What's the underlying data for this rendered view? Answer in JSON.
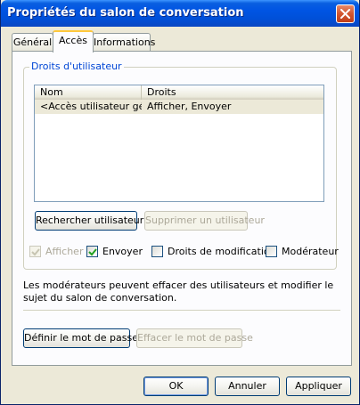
{
  "window": {
    "title": "Propriétés du salon de conversation"
  },
  "tabs": [
    {
      "label": "Général",
      "active": false
    },
    {
      "label": "Accès",
      "active": true
    },
    {
      "label": "Informations",
      "active": false
    }
  ],
  "rights_group": {
    "label": "Droits d'utilisateur",
    "columns": [
      "Nom",
      "Droits"
    ],
    "rows": [
      {
        "name": "<Accès utilisateur gé...",
        "rights": "Afficher, Envoyer"
      }
    ]
  },
  "buttons": {
    "search_user": "Rechercher utilisateur",
    "remove_user": "Supprimer un utilisateur",
    "set_password": "Définir le mot de passe",
    "clear_password": "Effacer le mot de passe",
    "ok": "OK",
    "cancel": "Annuler",
    "apply": "Appliquer"
  },
  "permissions": [
    {
      "label": "Afficher",
      "checked": true,
      "enabled": false
    },
    {
      "label": "Envoyer",
      "checked": true,
      "enabled": true
    },
    {
      "label": "Droits de modification",
      "checked": false,
      "enabled": true
    },
    {
      "label": "Modérateur",
      "checked": false,
      "enabled": true
    }
  ],
  "info_text": "Les modérateurs peuvent effacer des utilisateurs et modifier le sujet du salon de conversation.",
  "colors": {
    "titlebar": "#0054e3",
    "groupbox_label": "#0046d5",
    "tab_highlight": "#ffc83c",
    "close_button": "#d2552f"
  }
}
